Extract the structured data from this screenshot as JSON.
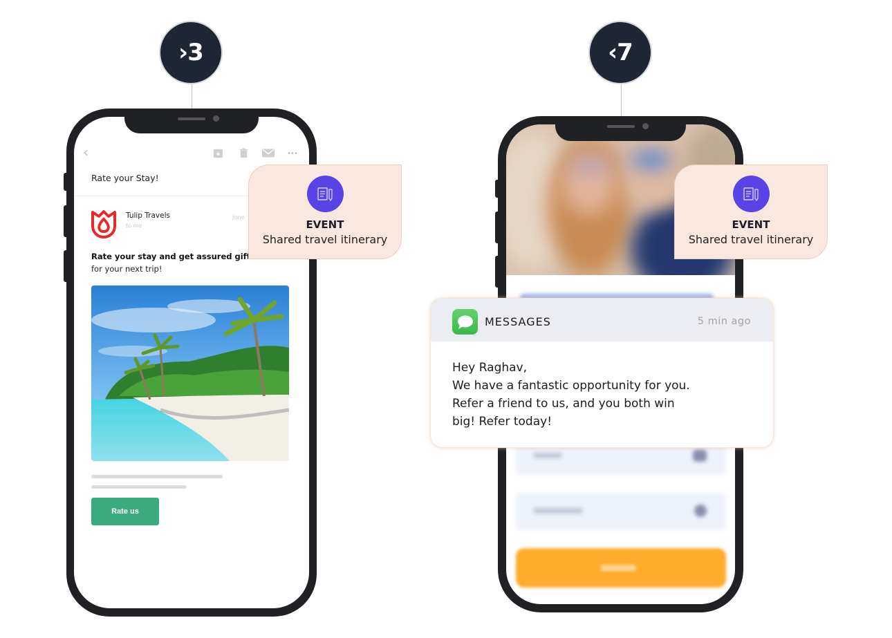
{
  "left_panel": {
    "badge": "›3",
    "email": {
      "toolbar_icons": [
        "back-chevron-icon",
        "archive-icon",
        "trash-icon",
        "mail-icon",
        "more-icon"
      ],
      "subject": "Rate your Stay!",
      "sender_name": "Tulip Travels",
      "sender_to": "to me",
      "date": "June",
      "headline_bold": "Rate your stay and get assured gifts",
      "headline_rest": "for your next trip!",
      "image_alt": "Tropical beach with palm trees",
      "cta_label": "Rate us",
      "cta_color": "#3bab7f",
      "brand_color": "#e62a2a"
    },
    "event": {
      "title": "EVENT",
      "description": "Shared travel itinerary"
    }
  },
  "right_panel": {
    "badge": "‹7",
    "event": {
      "title": "EVENT",
      "description": "Shared travel itinerary"
    },
    "notification": {
      "app_name": "MESSAGES",
      "time": "5 min ago",
      "lines": [
        "Hey Raghav,",
        "We have a fantastic opportunity for you.",
        "Refer a friend to us, and you both win",
        "big! Refer today!"
      ]
    },
    "login_button_color": "#ffab2d"
  },
  "colors": {
    "badge_bg": "#1e2533",
    "event_card_bg": "#f9e8e0",
    "event_icon_bg": "#5843e6",
    "phone_frame": "#1f2124"
  }
}
